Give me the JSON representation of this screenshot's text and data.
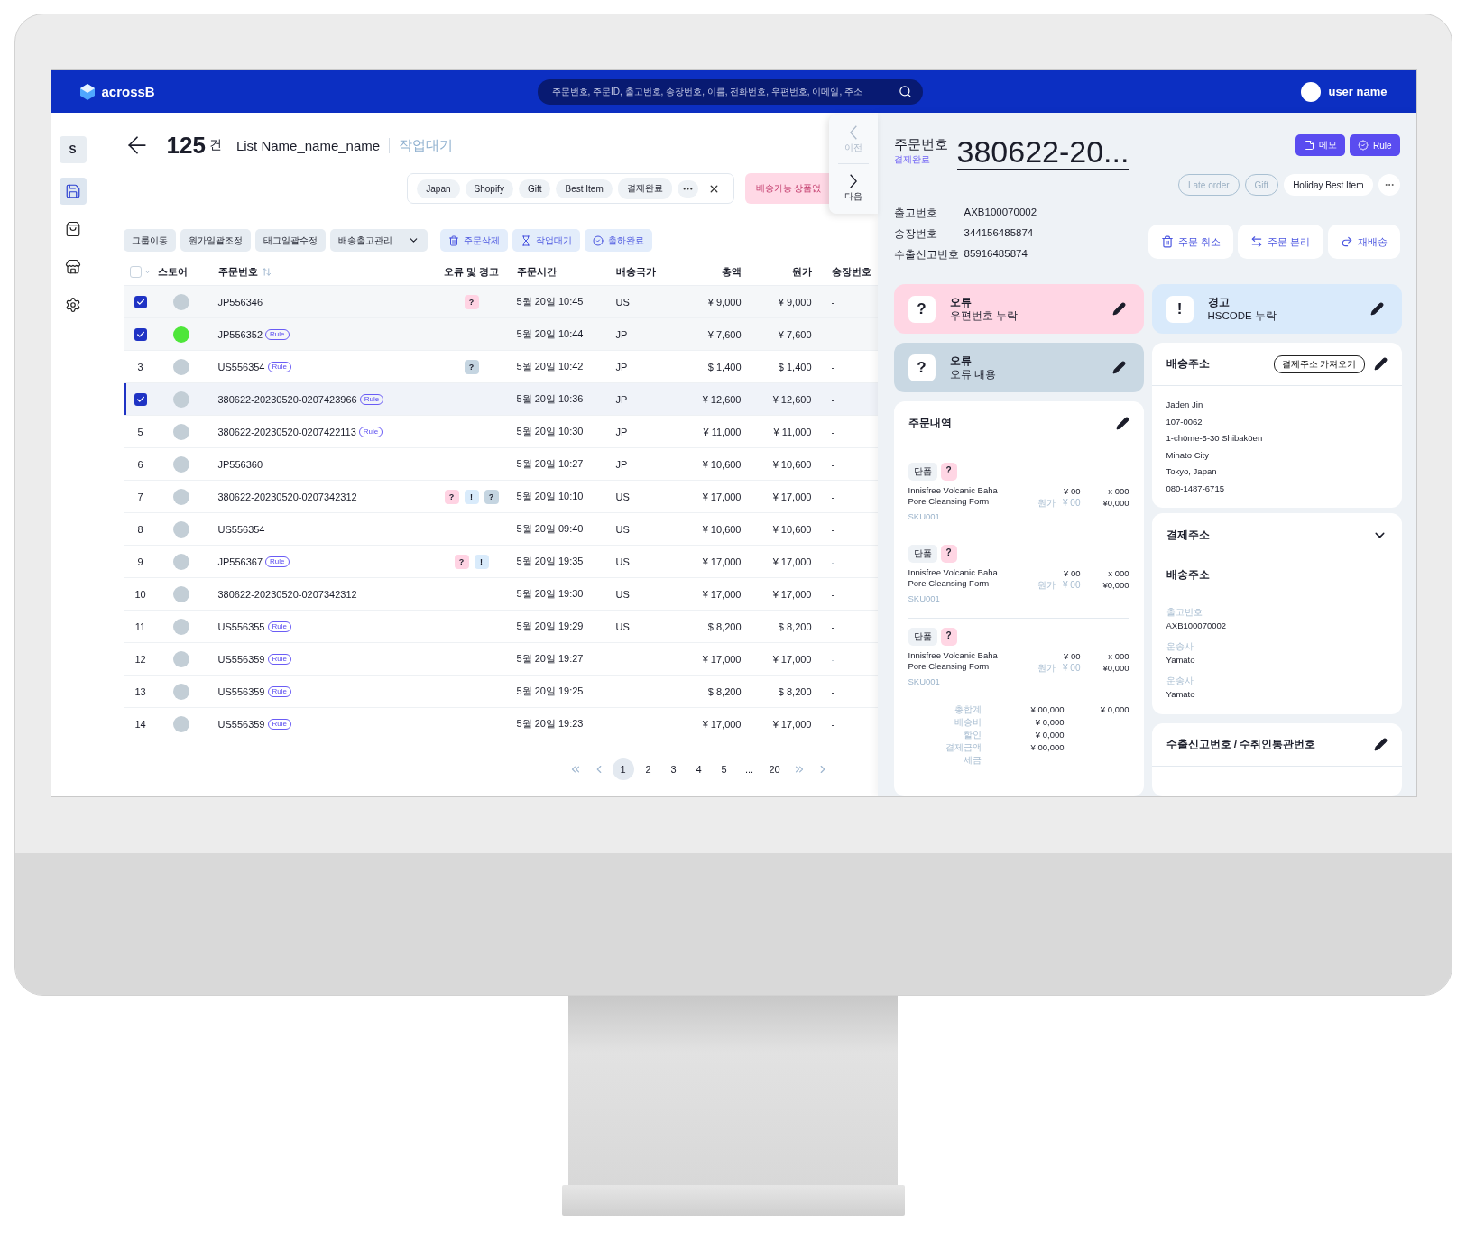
{
  "app": {
    "logo": "acrossB",
    "search_placeholder": "주문번호, 주문ID, 출고번호, 송장번호, 이름, 전화번호, 우편번호, 이메일, 주소",
    "user": "user name"
  },
  "sidebar": {
    "badge": "S",
    "items": [
      {
        "kind": "save",
        "selected": true
      },
      {
        "kind": "bag",
        "selected": false
      },
      {
        "kind": "store",
        "selected": false
      },
      {
        "kind": "settings",
        "selected": false
      }
    ]
  },
  "list_header": {
    "count": "125",
    "unit": "건",
    "name": "List Name_name_name",
    "status": "작업대기"
  },
  "filter_tags": [
    "Japan",
    "Shopify",
    "Gift",
    "Best Item",
    "결제완료"
  ],
  "alert_button": "배송가능 상품없",
  "toolbar": [
    {
      "label": "그룹이동",
      "kind": "plain"
    },
    {
      "label": "원가일괄조정",
      "kind": "plain"
    },
    {
      "label": "태그일괄수정",
      "kind": "plain"
    },
    {
      "label": "배송출고관리",
      "kind": "dropdown"
    },
    {
      "label": "주문삭제",
      "kind": "delete"
    },
    {
      "label": "작업대기",
      "kind": "wait"
    },
    {
      "label": "출하완료",
      "kind": "done"
    }
  ],
  "table": {
    "select_all_checked": false,
    "columns": [
      "스토어",
      "주문번호",
      "오류 및 경고",
      "주문시간",
      "배송국가",
      "총액",
      "원가",
      "송장번호"
    ],
    "rows": [
      {
        "checked": true,
        "selected": false,
        "store": {
          "color": "#c3ced6"
        },
        "order": "JP556346",
        "flags": [
          {
            "kind": "error",
            "mark": "?"
          }
        ],
        "time": "5월 20일 10:45",
        "country": "US",
        "total": "¥ 9,000",
        "cost": "¥ 9,000",
        "invoice": "-",
        "invoice_muted": false
      },
      {
        "checked": true,
        "selected": false,
        "store": {
          "color": "#4ee63a"
        },
        "order": "JP556352",
        "badge": "Rule",
        "time": "5월 20일 10:44",
        "country": "JP",
        "total": "¥ 7,600",
        "cost": "¥ 7,600",
        "invoice": "-",
        "invoice_muted": true
      },
      {
        "index": "3",
        "checked": false,
        "selected": false,
        "store": {
          "color": "#c3ced6"
        },
        "order": "US556354",
        "badge": "Rule",
        "flags": [
          {
            "kind": "info",
            "mark": "?"
          }
        ],
        "time": "5월 20일 10:42",
        "country": "JP",
        "total": "$ 1,400",
        "cost": "$ 1,400",
        "invoice": "-",
        "invoice_muted": false
      },
      {
        "checked": true,
        "selected": true,
        "store": {
          "color": "#c3ced6"
        },
        "order": "380622-20230520-0207423966",
        "badge": "Rule",
        "time": "5월 20일 10:36",
        "country": "JP",
        "total": "¥ 12,600",
        "cost": "¥ 12,600",
        "invoice": "-",
        "invoice_muted": false
      },
      {
        "index": "5",
        "checked": false,
        "selected": false,
        "store": {
          "color": "#c3ced6"
        },
        "order": "380622-20230520-0207422113",
        "badge": "Rule",
        "time": "5월 20일 10:30",
        "country": "JP",
        "total": "¥ 11,000",
        "cost": "¥ 11,000",
        "invoice": "-",
        "invoice_muted": false
      },
      {
        "index": "6",
        "checked": false,
        "selected": false,
        "store": {
          "color": "#c3ced6"
        },
        "order": "JP556360",
        "time": "5월 20일 10:27",
        "country": "JP",
        "total": "¥ 10,600",
        "cost": "¥ 10,600",
        "invoice": "-",
        "invoice_muted": false
      },
      {
        "index": "7",
        "checked": false,
        "selected": false,
        "store": {
          "color": "#c3ced6"
        },
        "order": "380622-20230520-0207342312",
        "flags": [
          {
            "kind": "error",
            "mark": "?"
          },
          {
            "kind": "warning",
            "mark": "!"
          },
          {
            "kind": "info",
            "mark": "?"
          }
        ],
        "time": "5월 20일 10:10",
        "country": "US",
        "total": "¥ 17,000",
        "cost": "¥ 17,000",
        "invoice": "-",
        "invoice_muted": false
      },
      {
        "index": "8",
        "checked": false,
        "selected": false,
        "store": {
          "color": "#c3ced6"
        },
        "order": "US556354",
        "time": "5월 20일 09:40",
        "country": "US",
        "total": "¥ 10,600",
        "cost": "¥ 10,600",
        "invoice": "-",
        "invoice_muted": false
      },
      {
        "index": "9",
        "checked": false,
        "selected": false,
        "store": {
          "color": "#c3ced6"
        },
        "order": "JP556367",
        "badge": "Rule",
        "flags": [
          {
            "kind": "error",
            "mark": "?"
          },
          {
            "kind": "warning",
            "mark": "!"
          }
        ],
        "time": "5월 20일 19:35",
        "country": "US",
        "total": "¥ 17,000",
        "cost": "¥ 17,000",
        "invoice": "-",
        "invoice_muted": true
      },
      {
        "index": "10",
        "checked": false,
        "selected": false,
        "store": {
          "color": "#c3ced6"
        },
        "order": "380622-20230520-0207342312",
        "time": "5월 20일 19:30",
        "country": "US",
        "total": "¥ 17,000",
        "cost": "¥ 17,000",
        "invoice": "-",
        "invoice_muted": false
      },
      {
        "index": "11",
        "checked": false,
        "selected": false,
        "store": {
          "color": "#c3ced6"
        },
        "order": "US556355",
        "badge": "Rule",
        "time": "5월 20일 19:29",
        "country": "US",
        "total": "$ 8,200",
        "cost": "$ 8,200",
        "invoice": "-",
        "invoice_muted": false
      },
      {
        "index": "12",
        "checked": false,
        "selected": false,
        "store": {
          "color": "#c3ced6"
        },
        "order": "US556359",
        "badge": "Rule",
        "time": "5월 20일 19:27",
        "total": "¥ 17,000",
        "cost": "¥ 17,000",
        "invoice": "-",
        "invoice_muted": true
      },
      {
        "index": "13",
        "checked": false,
        "selected": false,
        "store": {
          "color": "#c3ced6"
        },
        "order": "US556359",
        "badge": "Rule",
        "time": "5월 20일 19:25",
        "total": "$ 8,200",
        "cost": "$ 8,200",
        "invoice": "-",
        "invoice_muted": false
      },
      {
        "index": "14",
        "checked": false,
        "selected": false,
        "store": {
          "color": "#c3ced6"
        },
        "order": "US556359",
        "badge": "Rule",
        "time": "5월 20일 19:23",
        "total": "¥ 17,000",
        "cost": "¥ 17,000",
        "invoice": "-",
        "invoice_muted": false
      }
    ]
  },
  "pagination": [
    {
      "label": "1",
      "selected": true
    },
    {
      "label": "2",
      "selected": false
    },
    {
      "label": "3",
      "selected": false
    },
    {
      "label": "4",
      "selected": false
    },
    {
      "label": "5",
      "selected": false
    },
    {
      "label": "...",
      "selected": false
    },
    {
      "label": "20",
      "selected": false
    }
  ],
  "pager": {
    "prev": {
      "label": "이전",
      "disabled": true
    },
    "next": {
      "label": "다음",
      "disabled": false
    }
  },
  "order": {
    "label": "주문번호",
    "status": "결제완료",
    "number": "380622-20...",
    "buttons": [
      {
        "label": "메모",
        "kind": "memo"
      },
      {
        "label": "Rule",
        "kind": "rule"
      }
    ],
    "tags": [
      {
        "label": "Late order",
        "kind": "outline"
      },
      {
        "label": "Gift",
        "kind": "outline"
      },
      {
        "label": "Holiday Best Item",
        "kind": "filled"
      }
    ],
    "info": [
      {
        "label": "출고번호",
        "value": "AXB100070002"
      },
      {
        "label": "송장번호",
        "value": "344156485874"
      },
      {
        "label": "수출신고번호",
        "value": "85916485874"
      }
    ],
    "actions": [
      {
        "label": "주문 취소",
        "kind": "cancel"
      },
      {
        "label": "주문 분리",
        "kind": "split"
      },
      {
        "label": "재배송",
        "kind": "resend"
      }
    ]
  },
  "alerts_left": [
    {
      "kind": "error",
      "mark": "?",
      "title": "오류",
      "text": "우편번호 누락"
    },
    {
      "kind": "info",
      "mark": "?",
      "title": "오류",
      "text": "오류 내용"
    }
  ],
  "alerts_right": [
    {
      "kind": "warning",
      "mark": "!",
      "title": "경고",
      "text": "HSCODE 누락"
    }
  ],
  "order_items": {
    "title": "주문내역",
    "items": [
      {
        "tag": "단품",
        "flag": "?",
        "name": "Innisfree Volcanic Baha Pore Cleansing Form",
        "sku": "SKU001",
        "price": "¥ 00",
        "cost_label": "원가",
        "cost": "¥ 00",
        "qty": "x 000",
        "subtotal": "¥0,000"
      },
      {
        "tag": "단품",
        "flag": "?",
        "name": "Innisfree Volcanic Baha Pore Cleansing Form",
        "sku": "SKU001",
        "price": "¥ 00",
        "cost_label": "원가",
        "cost": "¥ 00",
        "qty": "x 000",
        "subtotal": "¥0,000"
      },
      {
        "tag": "단품",
        "flag": "?",
        "name": "Innisfree Volcanic Baha Pore Cleansing Form",
        "sku": "SKU001",
        "price": "¥ 00",
        "cost_label": "원가",
        "cost": "¥ 00",
        "qty": "x 000",
        "subtotal": "¥0,000"
      }
    ],
    "summary": [
      {
        "label": "총합계",
        "value": "¥ 00,000",
        "extra": "¥ 0,000"
      },
      {
        "label": "배송비",
        "value": "¥ 0,000"
      },
      {
        "label": "할인",
        "value": "¥ 0,000"
      },
      {
        "label": "결제금액",
        "value": "¥ 00,000"
      },
      {
        "label": "세금"
      }
    ]
  },
  "shipping_address": {
    "title": "배송주소",
    "button": "결제주소 가져오기",
    "lines": [
      "Jaden Jin",
      "107-0062",
      "1-chōme-5-30 Shibakōen",
      "Minato City",
      "Tokyo,  Japan",
      "080-1487-6715"
    ]
  },
  "billing_address": {
    "title": "결제주소",
    "expanded": false
  },
  "shipment": {
    "title": "배송주소",
    "fields": [
      {
        "label": "출고번호",
        "value": "AXB100070002"
      },
      {
        "label": "운송사",
        "value": "Yamato"
      },
      {
        "label": "운송사",
        "value": "Yamato"
      }
    ]
  },
  "customs": {
    "title": "수출신고번호 / 수취인통관번호"
  }
}
